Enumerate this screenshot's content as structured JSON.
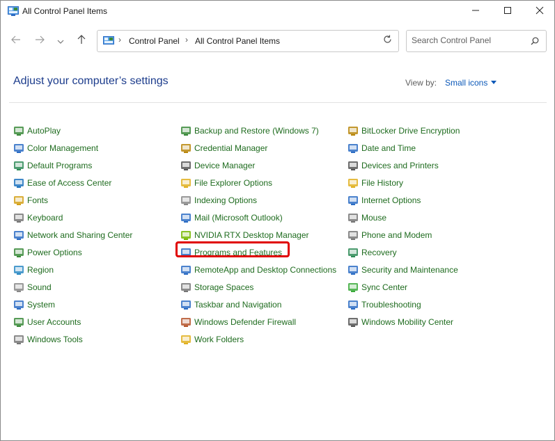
{
  "window": {
    "title": "All Control Panel Items",
    "controls": [
      "minimize",
      "maximize",
      "close"
    ]
  },
  "nav": {
    "address": [
      "Control Panel",
      "All Control Panel Items"
    ],
    "search_placeholder": "Search Control Panel"
  },
  "main": {
    "heading": "Adjust your computer’s settings",
    "view_by_label": "View by:",
    "view_by_value": "Small icons"
  },
  "columns": [
    [
      {
        "label": "AutoPlay",
        "icon": "autoplay-icon",
        "color": "#3a8a3a"
      },
      {
        "label": "Color Management",
        "icon": "color-management-icon",
        "color": "#2b6cc4"
      },
      {
        "label": "Default Programs",
        "icon": "default-programs-icon",
        "color": "#2e8b57"
      },
      {
        "label": "Ease of Access Center",
        "icon": "ease-of-access-icon",
        "color": "#1e73be"
      },
      {
        "label": "Fonts",
        "icon": "fonts-icon",
        "color": "#d4a017"
      },
      {
        "label": "Keyboard",
        "icon": "keyboard-icon",
        "color": "#777777"
      },
      {
        "label": "Network and Sharing Center",
        "icon": "network-icon",
        "color": "#2b6cc4"
      },
      {
        "label": "Power Options",
        "icon": "power-options-icon",
        "color": "#3a8a3a"
      },
      {
        "label": "Region",
        "icon": "region-icon",
        "color": "#2b8ac4"
      },
      {
        "label": "Sound",
        "icon": "sound-icon",
        "color": "#888888"
      },
      {
        "label": "System",
        "icon": "system-icon",
        "color": "#2b6cc4"
      },
      {
        "label": "User Accounts",
        "icon": "user-accounts-icon",
        "color": "#3a8a3a"
      },
      {
        "label": "Windows Tools",
        "icon": "windows-tools-icon",
        "color": "#777777"
      }
    ],
    [
      {
        "label": "Backup and Restore (Windows 7)",
        "icon": "backup-restore-icon",
        "color": "#3a8a3a"
      },
      {
        "label": "Credential Manager",
        "icon": "credential-manager-icon",
        "color": "#b8860b"
      },
      {
        "label": "Device Manager",
        "icon": "device-manager-icon",
        "color": "#555555"
      },
      {
        "label": "File Explorer Options",
        "icon": "file-explorer-options-icon",
        "color": "#e0b020"
      },
      {
        "label": "Indexing Options",
        "icon": "indexing-options-icon",
        "color": "#888888"
      },
      {
        "label": "Mail (Microsoft Outlook)",
        "icon": "mail-icon",
        "color": "#2b6cc4"
      },
      {
        "label": "NVIDIA RTX Desktop Manager",
        "icon": "nvidia-icon",
        "color": "#76b900"
      },
      {
        "label": "Programs and Features",
        "icon": "programs-features-icon",
        "color": "#2b6cc4"
      },
      {
        "label": "RemoteApp and Desktop Connections",
        "icon": "remoteapp-icon",
        "color": "#2b6cc4"
      },
      {
        "label": "Storage Spaces",
        "icon": "storage-spaces-icon",
        "color": "#777777"
      },
      {
        "label": "Taskbar and Navigation",
        "icon": "taskbar-icon",
        "color": "#2b6cc4"
      },
      {
        "label": "Windows Defender Firewall",
        "icon": "firewall-icon",
        "color": "#b5542b"
      },
      {
        "label": "Work Folders",
        "icon": "work-folders-icon",
        "color": "#e0b020"
      }
    ],
    [
      {
        "label": "BitLocker Drive Encryption",
        "icon": "bitlocker-icon",
        "color": "#b8860b"
      },
      {
        "label": "Date and Time",
        "icon": "date-time-icon",
        "color": "#2b6cc4"
      },
      {
        "label": "Devices and Printers",
        "icon": "devices-printers-icon",
        "color": "#555555"
      },
      {
        "label": "File History",
        "icon": "file-history-icon",
        "color": "#e0b020"
      },
      {
        "label": "Internet Options",
        "icon": "internet-options-icon",
        "color": "#2b6cc4"
      },
      {
        "label": "Mouse",
        "icon": "mouse-icon",
        "color": "#777777"
      },
      {
        "label": "Phone and Modem",
        "icon": "phone-modem-icon",
        "color": "#777777"
      },
      {
        "label": "Recovery",
        "icon": "recovery-icon",
        "color": "#2e8b57"
      },
      {
        "label": "Security and Maintenance",
        "icon": "security-maintenance-icon",
        "color": "#2b6cc4"
      },
      {
        "label": "Sync Center",
        "icon": "sync-center-icon",
        "color": "#3aaa3a"
      },
      {
        "label": "Troubleshooting",
        "icon": "troubleshooting-icon",
        "color": "#2b6cc4"
      },
      {
        "label": "Windows Mobility Center",
        "icon": "mobility-center-icon",
        "color": "#555555"
      }
    ]
  ],
  "highlighted_item": "Programs and Features",
  "colors": {
    "heading": "#1c3c8c",
    "link": "#1e6b1e",
    "view_by": "#0b58b8",
    "highlight": "#e00000"
  }
}
